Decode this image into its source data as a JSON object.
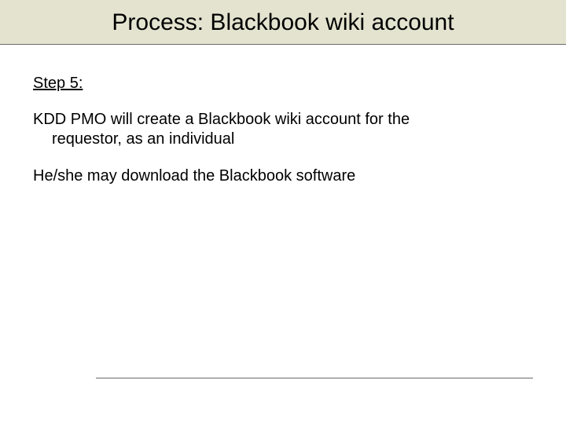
{
  "title": "Process: Blackbook wiki account",
  "step_label": "Step 5:",
  "para1_line1": "KDD PMO will create a Blackbook wiki account for the",
  "para1_line2": "requestor, as an individual",
  "para2": "He/she may download the Blackbook software"
}
